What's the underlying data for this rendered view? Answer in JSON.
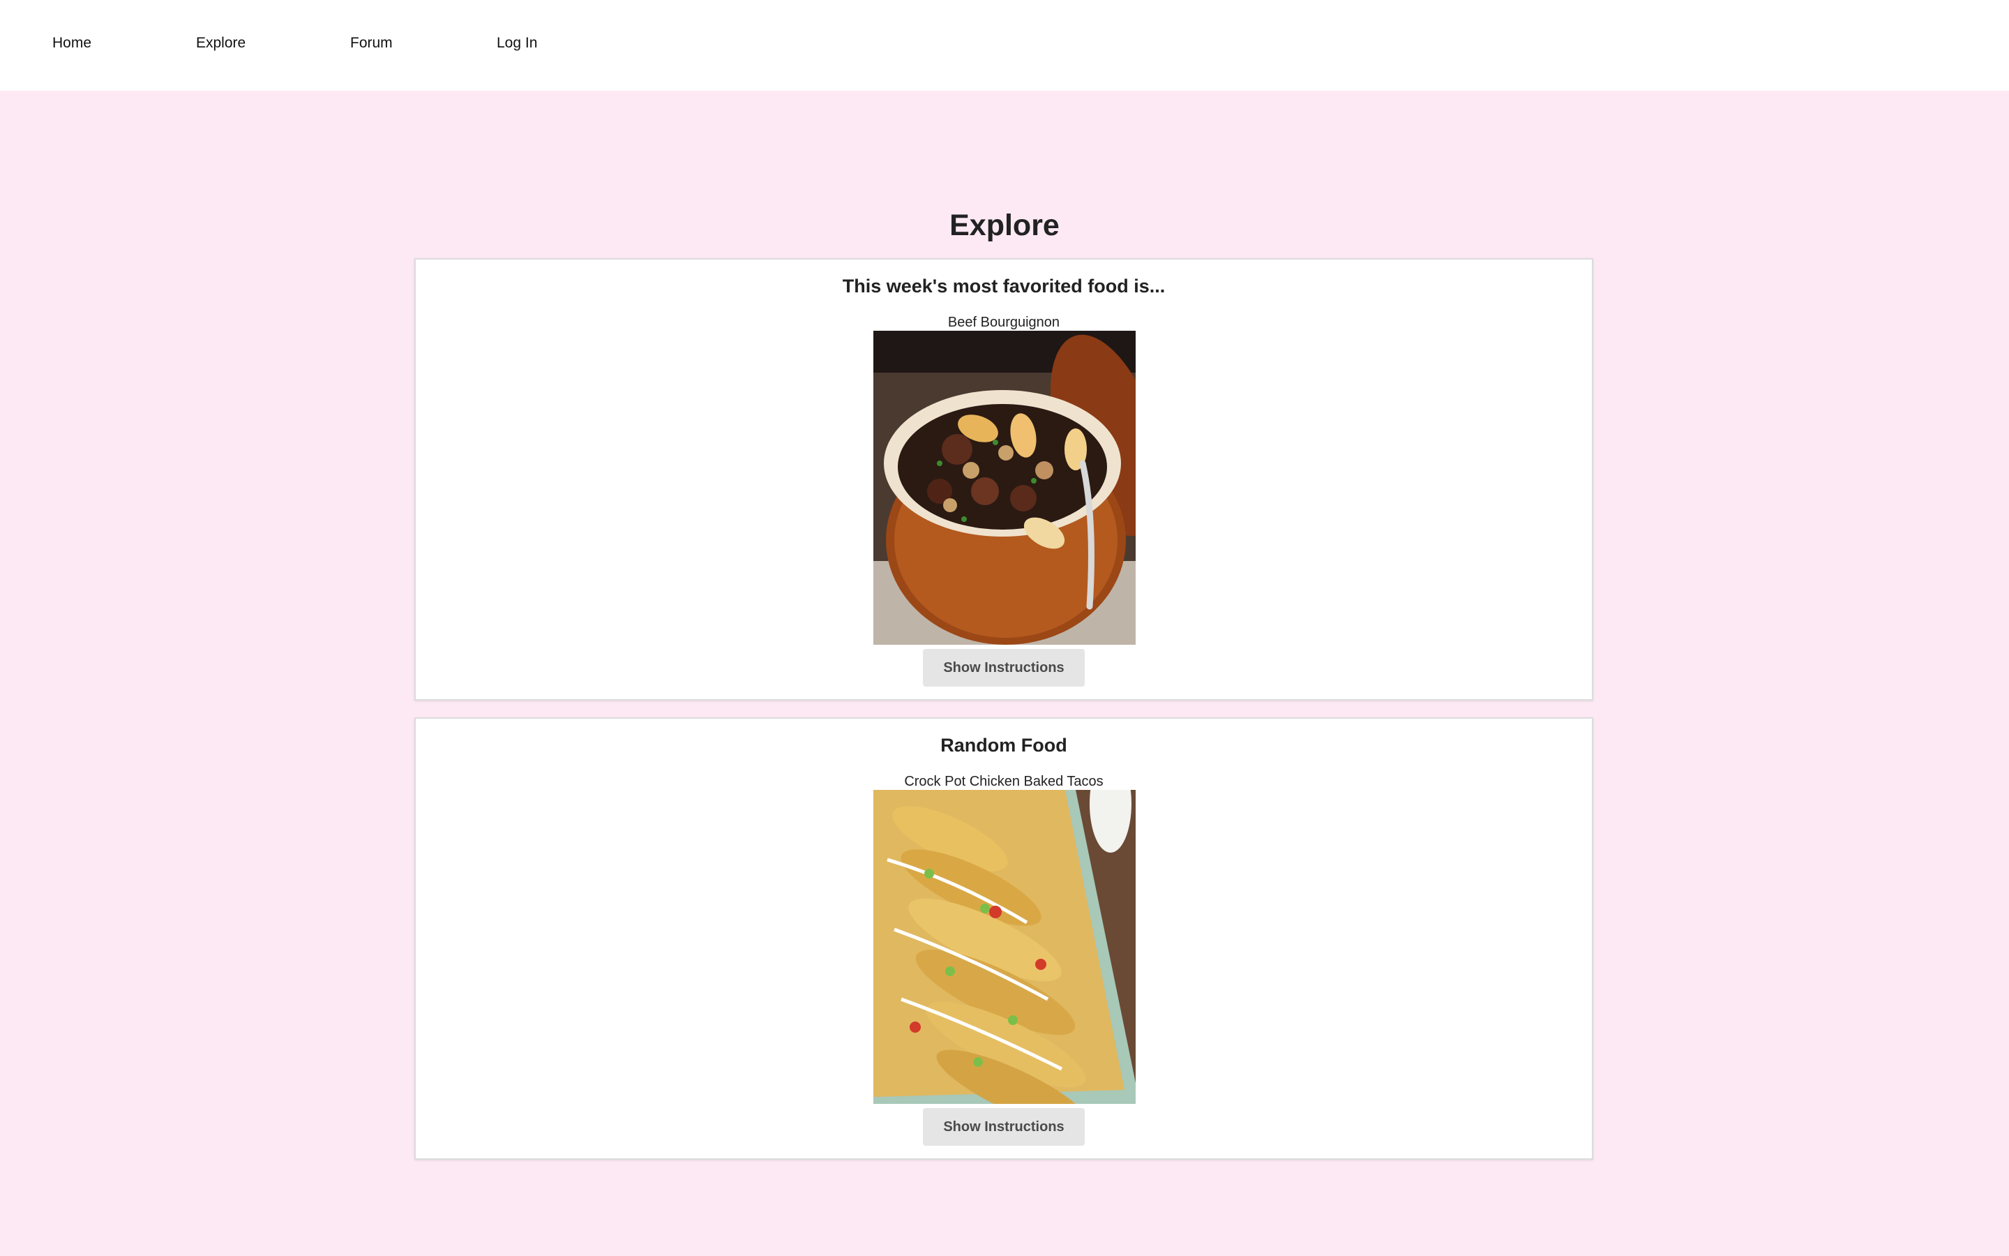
{
  "nav": {
    "items": [
      {
        "label": "Home"
      },
      {
        "label": "Explore"
      },
      {
        "label": "Forum"
      },
      {
        "label": "Log In"
      }
    ]
  },
  "page": {
    "title": "Explore"
  },
  "cards": [
    {
      "heading": "This week's most favorited food is...",
      "food_name": "Beef Bourguignon",
      "button_label": "Show Instructions"
    },
    {
      "heading": "Random Food",
      "food_name": "Crock Pot Chicken Baked Tacos",
      "button_label": "Show Instructions"
    }
  ],
  "colors": {
    "page_background": "#fde9f4",
    "nav_background": "#ffffff",
    "card_background": "#ffffff",
    "button_background": "#e5e5e5"
  }
}
